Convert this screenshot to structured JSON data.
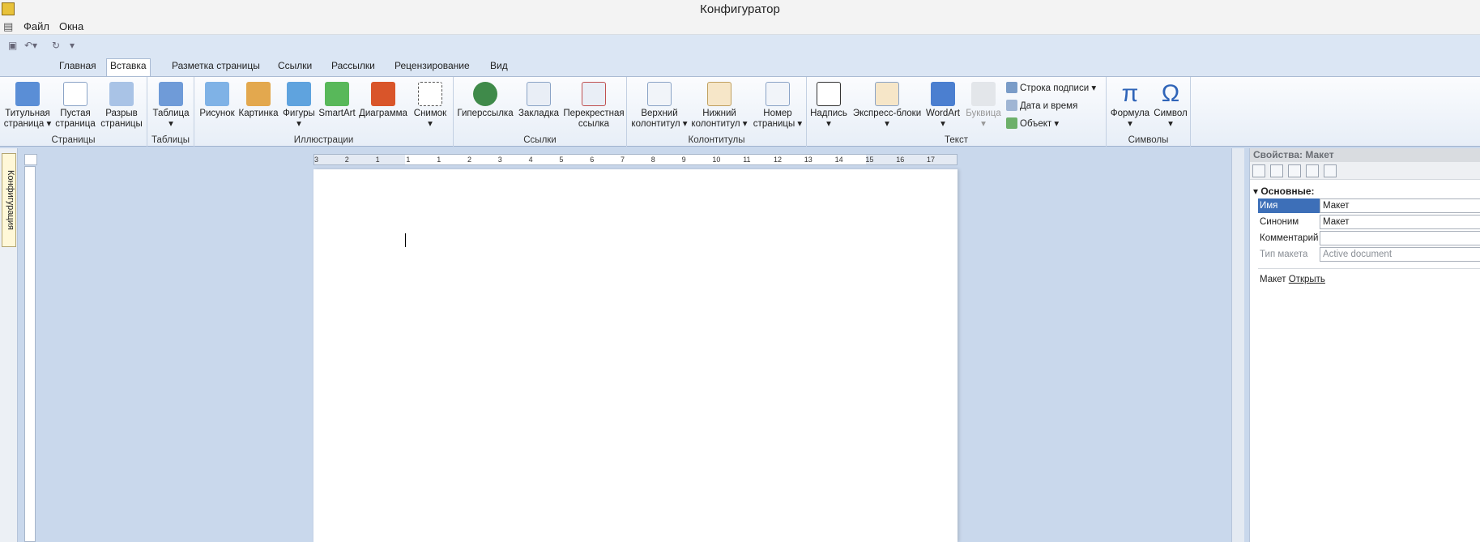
{
  "window": {
    "title": "Конфигуратор"
  },
  "menu": [
    "Файл",
    "Окна"
  ],
  "tabs": [
    "Главная",
    "Вставка",
    "Разметка страницы",
    "Ссылки",
    "Рассылки",
    "Рецензирование",
    "Вид"
  ],
  "active_tab": "Вставка",
  "ribbon": {
    "pages": {
      "label": "Страницы",
      "btns": [
        [
          "Титульная",
          "страница ▾"
        ],
        [
          "Пустая",
          "страница"
        ],
        [
          "Разрыв",
          "страницы"
        ]
      ]
    },
    "tables": {
      "label": "Таблицы",
      "btns": [
        [
          "Таблица",
          "▾"
        ]
      ]
    },
    "illus": {
      "label": "Иллюстрации",
      "btns": [
        [
          "Рисунок",
          ""
        ],
        [
          "Картинка",
          ""
        ],
        [
          "Фигуры",
          "▾"
        ],
        [
          "SmartArt",
          ""
        ],
        [
          "Диаграмма",
          ""
        ],
        [
          "Снимок",
          "▾"
        ]
      ]
    },
    "links": {
      "label": "Ссылки",
      "btns": [
        [
          "Гиперссылка",
          ""
        ],
        [
          "Закладка",
          ""
        ],
        [
          "Перекрестная",
          "ссылка"
        ]
      ]
    },
    "hf": {
      "label": "Колонтитулы",
      "btns": [
        [
          "Верхний",
          "колонтитул ▾"
        ],
        [
          "Нижний",
          "колонтитул ▾"
        ],
        [
          "Номер",
          "страницы ▾"
        ]
      ]
    },
    "text": {
      "label": "Текст",
      "btns": [
        [
          "Надпись",
          "▾"
        ],
        [
          "Экспресс-блоки",
          "▾"
        ],
        [
          "WordArt",
          "▾"
        ],
        [
          "Буквица",
          "▾"
        ]
      ],
      "small": [
        "Строка подписи ▾",
        "Дата и время",
        "Объект ▾"
      ]
    },
    "symbols": {
      "label": "Символы",
      "btns": [
        [
          "Формула",
          "▾"
        ],
        [
          "Символ",
          "▾"
        ]
      ]
    }
  },
  "left_panel": "Конфигурация",
  "ruler_ticks": [
    "3",
    "2",
    "1",
    "1",
    "1",
    "2",
    "3",
    "4",
    "5",
    "6",
    "7",
    "8",
    "9",
    "10",
    "11",
    "12",
    "13",
    "14",
    "15",
    "16",
    "17"
  ],
  "properties": {
    "title": "Свойства: Макет",
    "section": "Основные:",
    "rows": [
      {
        "k": "Имя",
        "v": "Макет"
      },
      {
        "k": "Синоним",
        "v": "Макет"
      },
      {
        "k": "Комментарий",
        "v": ""
      },
      {
        "k": "Тип макета",
        "v": "Active document"
      }
    ],
    "link_label": "Макет",
    "link_text": "Открыть"
  }
}
